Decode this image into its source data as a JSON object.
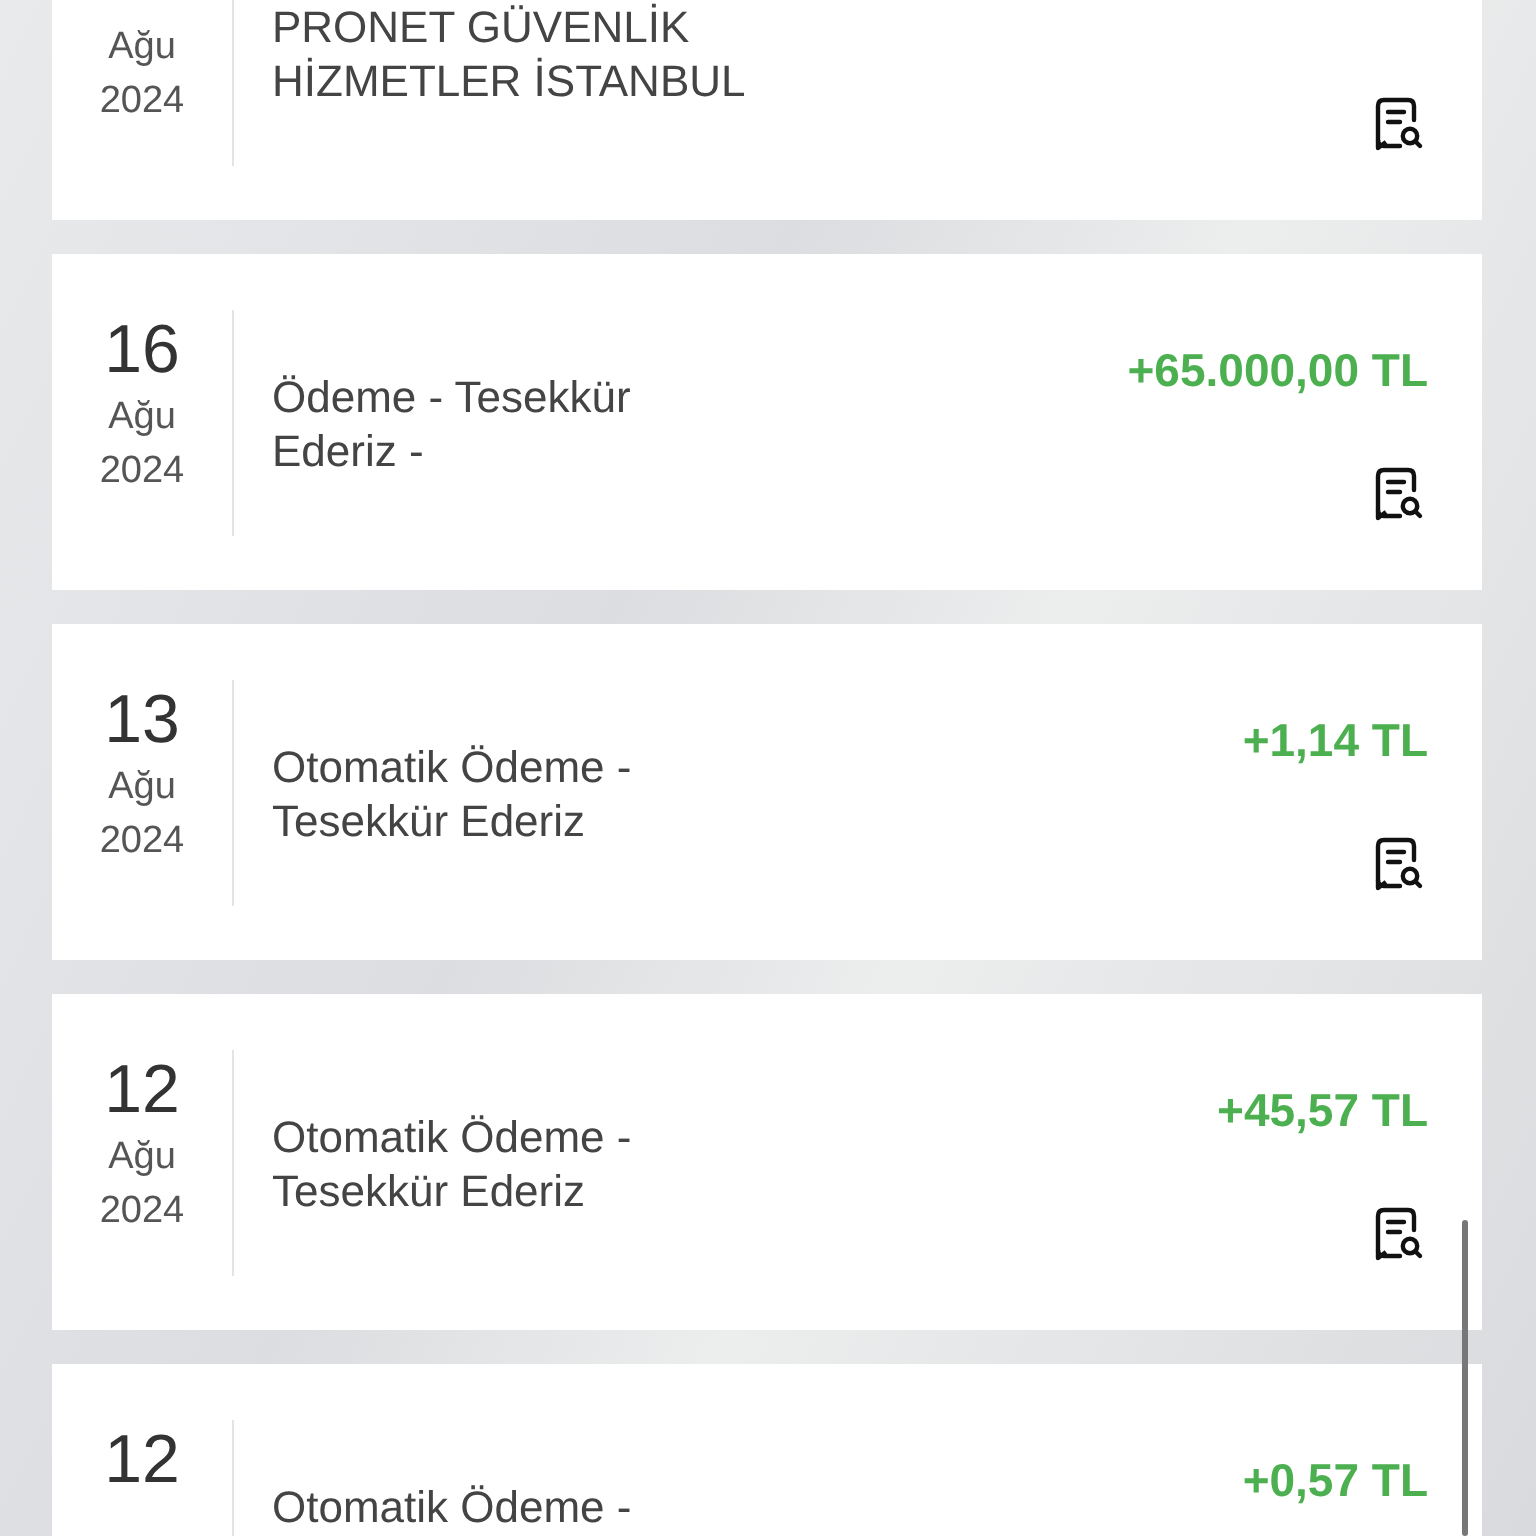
{
  "transactions": [
    {
      "month": "Ağu",
      "year": "2024",
      "description": "PRONET GÜVENLİK HİZMETLER İSTANBUL",
      "receipt_icon": true
    },
    {
      "day": "16",
      "month": "Ağu",
      "year": "2024",
      "description": "Ödeme - Tesekkür Ederiz -",
      "amount": "+65.000,00 TL",
      "receipt_icon": true
    },
    {
      "day": "13",
      "month": "Ağu",
      "year": "2024",
      "description": "Otomatik Ödeme - Tesekkür Ederiz",
      "amount": "+1,14 TL",
      "receipt_icon": true
    },
    {
      "day": "12",
      "month": "Ağu",
      "year": "2024",
      "description": "Otomatik Ödeme - Tesekkür Ederiz",
      "amount": "+45,57 TL",
      "receipt_icon": true
    },
    {
      "day": "12",
      "description": "Otomatik Ödeme -",
      "amount": "+0,57 TL"
    }
  ]
}
